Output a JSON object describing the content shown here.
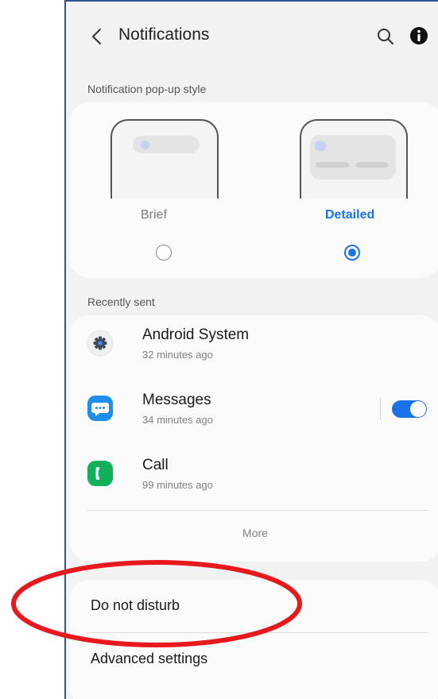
{
  "header": {
    "title": "Notifications",
    "back_icon": "chevron-left-icon",
    "search_icon": "search-icon",
    "info_icon": "info-icon"
  },
  "popup_style": {
    "section_label": "Notification pop-up style",
    "options": [
      {
        "label": "Brief",
        "selected": false
      },
      {
        "label": "Detailed",
        "selected": true
      }
    ]
  },
  "recently_sent": {
    "section_label": "Recently sent",
    "apps": [
      {
        "name": "Android System",
        "time": "32 minutes ago",
        "icon": "gear-icon"
      },
      {
        "name": "Messages",
        "time": "34 minutes ago",
        "icon": "chat-bubble-icon",
        "toggle_on": true
      },
      {
        "name": "Call",
        "time": "99 minutes ago",
        "icon": "phone-icon"
      }
    ],
    "more_label": "More"
  },
  "settings": {
    "items": [
      "Do not disturb",
      "Advanced settings"
    ]
  },
  "colors": {
    "accent": "#1a73e8",
    "annotation": "#e8181c",
    "frame_border": "#2f5597",
    "messages_icon": "#1f8ef1",
    "call_icon": "#12b05a"
  }
}
